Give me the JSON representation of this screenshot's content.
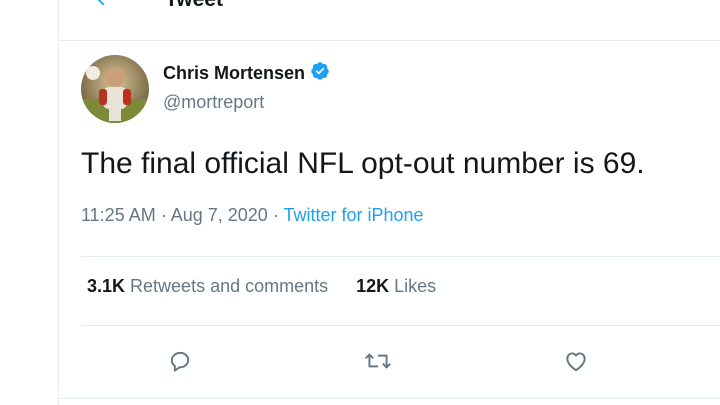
{
  "header": {
    "title": "Tweet",
    "back_icon": "arrow-left-icon",
    "accent": "#1da1f2"
  },
  "tweet": {
    "author": {
      "name": "Chris Mortensen",
      "handle": "@mortreport",
      "verified_icon": "verified-badge-icon"
    },
    "text": "The final official NFL opt-out number is 69.",
    "timestamp": "11:25 AM · Aug 7, 2020",
    "separator": " · ",
    "source": "Twitter for iPhone",
    "stats": {
      "retweets_count": "3.1K",
      "retweets_label": " Retweets and comments",
      "likes_count": "12K",
      "likes_label": " Likes"
    },
    "actions": [
      "reply-icon",
      "retweet-icon",
      "like-icon"
    ]
  }
}
